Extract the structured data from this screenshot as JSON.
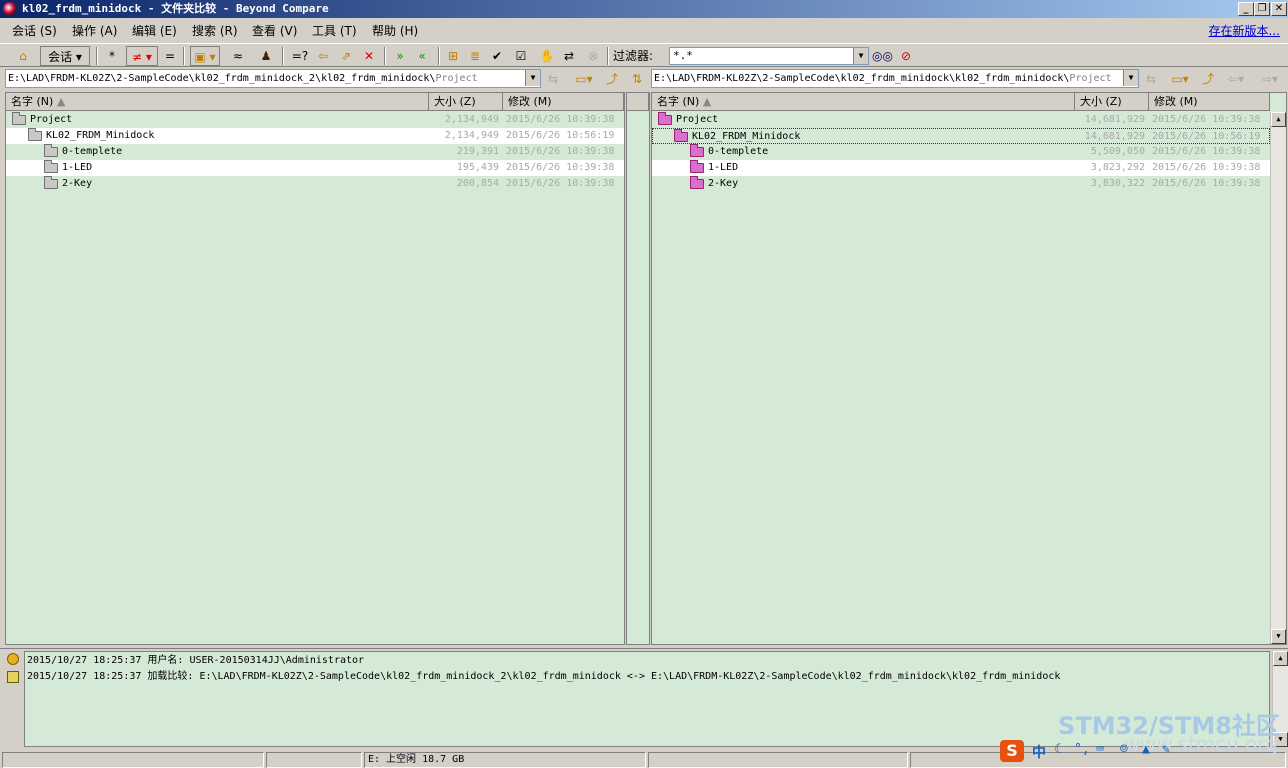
{
  "window": {
    "title": "kl02_frdm_minidock - 文件夹比较 - Beyond Compare"
  },
  "menu": {
    "items": [
      "会话 (S)",
      "操作 (A)",
      "编辑 (E)",
      "搜索 (R)",
      "查看 (V)",
      "工具 (T)",
      "帮助 (H)"
    ],
    "new_version_link": "存在新版本..."
  },
  "toolbar": {
    "session_label": "会话",
    "filter_label": "过滤器:",
    "filter_value": "*.*",
    "icons": [
      "home-icon",
      "all-icon",
      "diffs-icon",
      "same-icon",
      "structure-icon",
      "similar-icon",
      "person-icon",
      "compare-icon",
      "copy-left-icon",
      "copy-to-folder-icon",
      "delete-icon",
      "sync-right-icon",
      "sync-left-icon",
      "expand-icon",
      "collapse-icon",
      "select-icon",
      "select-all-icon",
      "touch-icon",
      "swap-icon",
      "stop-icon",
      "glasses-icon",
      "no-glasses-icon"
    ]
  },
  "left": {
    "path_main": "E:\\LAD\\FRDM-KL02Z\\2-SampleCode\\kl02_frdm_minidock_2\\kl02_frdm_minidock\\",
    "path_tail": "Project",
    "headers": {
      "name": "名字 (N)",
      "size": "大小 (Z)",
      "modified": "修改 (M)"
    },
    "rows": [
      {
        "name": "Project",
        "size": "2,134,949",
        "date": "2015/6/26 10:39:38"
      },
      {
        "name": "KL02_FRDM_Minidock",
        "size": "2,134,949",
        "date": "2015/6/26 10:56:19"
      },
      {
        "name": "0-templete",
        "size": "219,391",
        "date": "2015/6/26 10:39:38"
      },
      {
        "name": "1-LED",
        "size": "195,439",
        "date": "2015/6/26 10:39:38"
      },
      {
        "name": "2-Key",
        "size": "200,854",
        "date": "2015/6/26 10:39:38"
      }
    ]
  },
  "right": {
    "path_main": "E:\\LAD\\FRDM-KL02Z\\2-SampleCode\\kl02_frdm_minidock\\kl02_frdm_minidock\\",
    "path_tail": "Project",
    "headers": {
      "name": "名字 (N)",
      "size": "大小 (Z)",
      "modified": "修改 (M)"
    },
    "rows": [
      {
        "name": "Project",
        "size": "14,681,929",
        "date": "2015/6/26 10:39:38"
      },
      {
        "name": "KL02_FRDM_Minidock",
        "size": "14,681,929",
        "date": "2015/6/26 10:56:19"
      },
      {
        "name": "0-templete",
        "size": "5,509,050",
        "date": "2015/6/26 10:39:38"
      },
      {
        "name": "1-LED",
        "size": "3,823,292",
        "date": "2015/6/26 10:39:38"
      },
      {
        "name": "2-Key",
        "size": "3,830,322",
        "date": "2015/6/26 10:39:38"
      }
    ]
  },
  "log": [
    "2015/10/27 18:25:37  用户名:  USER-20150314JJ\\Administrator",
    "2015/10/27 18:25:37  加载比较: E:\\LAD\\FRDM-KL02Z\\2-SampleCode\\kl02_frdm_minidock_2\\kl02_frdm_minidock <-> E:\\LAD\\FRDM-KL02Z\\2-SampleCode\\kl02_frdm_minidock\\kl02_frdm_minidock"
  ],
  "status": {
    "free_space": "E: 上空闲 18.7 GB"
  },
  "watermark": {
    "line1": "STM32/STM8社区",
    "line2": "www.stmcu.org"
  },
  "ime": {
    "label": "中"
  }
}
